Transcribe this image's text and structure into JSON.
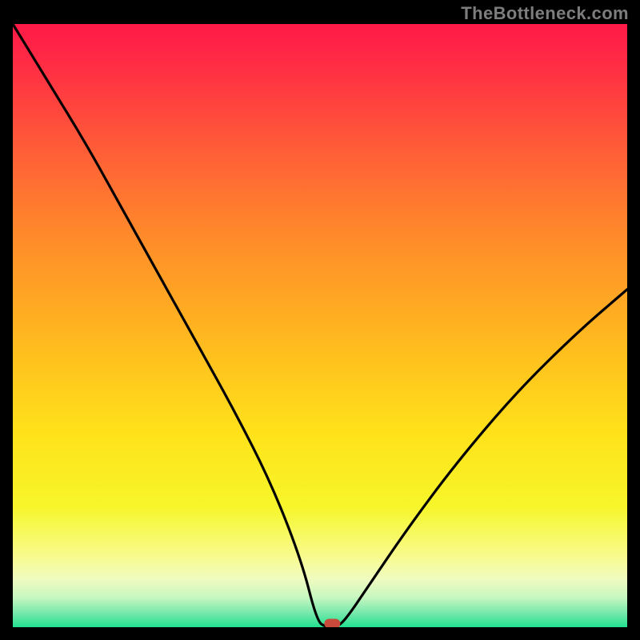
{
  "watermark": "TheBottleneck.com",
  "chart_data": {
    "type": "line",
    "title": "",
    "xlabel": "",
    "ylabel": "",
    "xlim": [
      0,
      100
    ],
    "ylim": [
      0,
      100
    ],
    "series": [
      {
        "name": "bottleneck-curve",
        "x": [
          0,
          6,
          12,
          18,
          24,
          30,
          36,
          42,
          47,
          49.5,
          51,
          52.5,
          54,
          58,
          64,
          72,
          82,
          92,
          100
        ],
        "values": [
          100,
          90,
          80,
          69,
          58,
          47,
          36,
          24,
          11,
          1,
          0,
          0,
          1,
          7,
          16,
          27,
          39,
          49,
          56
        ]
      }
    ],
    "marker": {
      "x": 52,
      "y": 0.6
    },
    "gradient_stops": [
      {
        "offset": 0.0,
        "color": "#ff1a47"
      },
      {
        "offset": 0.06,
        "color": "#ff2a45"
      },
      {
        "offset": 0.2,
        "color": "#ff5a38"
      },
      {
        "offset": 0.35,
        "color": "#ff8a2a"
      },
      {
        "offset": 0.52,
        "color": "#ffb81f"
      },
      {
        "offset": 0.68,
        "color": "#ffe21a"
      },
      {
        "offset": 0.8,
        "color": "#f6f62a"
      },
      {
        "offset": 0.88,
        "color": "#f8fb8a"
      },
      {
        "offset": 0.92,
        "color": "#f0fbc0"
      },
      {
        "offset": 0.95,
        "color": "#c8f7c0"
      },
      {
        "offset": 0.975,
        "color": "#7ce9ad"
      },
      {
        "offset": 1.0,
        "color": "#22e08f"
      }
    ]
  }
}
